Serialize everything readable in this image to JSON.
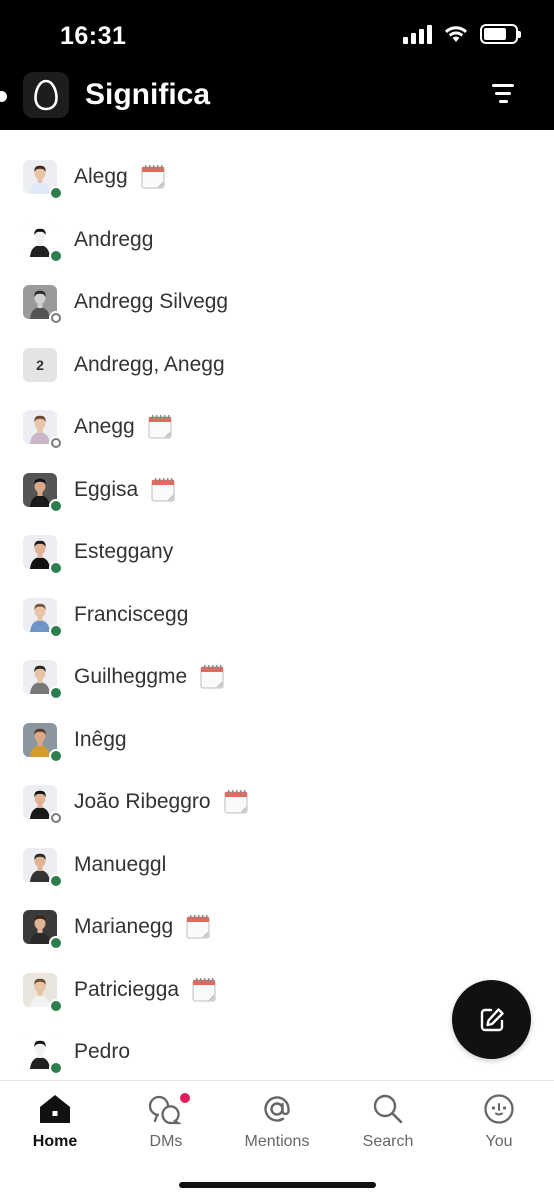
{
  "status_bar": {
    "time": "16:31"
  },
  "header": {
    "workspace_name": "Significa"
  },
  "conversations": [
    {
      "name": "Alegg",
      "presence": "active",
      "calendar": true,
      "kind": "person",
      "skin": "#e8c4a6",
      "hair": "#3a2a22",
      "shirt": "#dfe8f5",
      "bg": "#eceef2"
    },
    {
      "name": "Andregg",
      "presence": "active",
      "calendar": false,
      "kind": "person",
      "skin": "#f2f2f2",
      "hair": "#111111",
      "shirt": "#222222",
      "bg": "#ffffff"
    },
    {
      "name": "Andregg Silvegg",
      "presence": "away",
      "calendar": false,
      "kind": "person",
      "skin": "#cfcfcf",
      "hair": "#2b2b2b",
      "shirt": "#555555",
      "bg": "#9a9a9a"
    },
    {
      "name": "Andregg, Anegg",
      "presence": "none",
      "calendar": false,
      "kind": "group",
      "count": "2"
    },
    {
      "name": "Anegg",
      "presence": "away",
      "calendar": true,
      "kind": "person",
      "skin": "#e8c4a6",
      "hair": "#6b4a36",
      "shirt": "#c9b7c7",
      "bg": "#eceef2"
    },
    {
      "name": "Eggisa",
      "presence": "active",
      "calendar": true,
      "kind": "person",
      "skin": "#d9a98a",
      "hair": "#111111",
      "shirt": "#1a1a1a",
      "bg": "#555555"
    },
    {
      "name": "Esteggany",
      "presence": "active",
      "calendar": false,
      "kind": "person",
      "skin": "#e0b394",
      "hair": "#1a1a1a",
      "shirt": "#111111",
      "bg": "#eceef2"
    },
    {
      "name": "Franciscegg",
      "presence": "active",
      "calendar": false,
      "kind": "person",
      "skin": "#e8c4a6",
      "hair": "#7a5a3e",
      "shirt": "#6f95c7",
      "bg": "#eceef2"
    },
    {
      "name": "Guilheggme",
      "presence": "active",
      "calendar": true,
      "kind": "person",
      "skin": "#e8c4a6",
      "hair": "#2a2a2a",
      "shirt": "#777777",
      "bg": "#eceef2"
    },
    {
      "name": "Inêgg",
      "presence": "active",
      "calendar": false,
      "kind": "person",
      "skin": "#d9a98a",
      "hair": "#5a3a24",
      "shirt": "#d29a2f",
      "bg": "#8a97a0"
    },
    {
      "name": "João Ribeggro",
      "presence": "away",
      "calendar": true,
      "kind": "person",
      "skin": "#e0b394",
      "hair": "#111111",
      "shirt": "#1a1a1a",
      "bg": "#eceef2"
    },
    {
      "name": "Manueggl",
      "presence": "active",
      "calendar": false,
      "kind": "person",
      "skin": "#e0b394",
      "hair": "#2a2a2a",
      "shirt": "#333333",
      "bg": "#eceef2"
    },
    {
      "name": "Marianegg",
      "presence": "active",
      "calendar": true,
      "kind": "person",
      "skin": "#e0b394",
      "hair": "#3a2418",
      "shirt": "#2a2a2a",
      "bg": "#3a3a3a"
    },
    {
      "name": "Patriciegga",
      "presence": "active",
      "calendar": true,
      "kind": "person",
      "skin": "#e8c4a6",
      "hair": "#6b4a30",
      "shirt": "#f2f2f2",
      "bg": "#e9e4dc"
    },
    {
      "name": "Pedro",
      "presence": "active",
      "calendar": false,
      "kind": "person",
      "skin": "#f2f2f2",
      "hair": "#111111",
      "shirt": "#222222",
      "bg": "#ffffff"
    }
  ],
  "tabs": [
    {
      "label": "Home",
      "icon": "home-icon",
      "active": true
    },
    {
      "label": "DMs",
      "icon": "dms-icon",
      "active": false,
      "badge": true
    },
    {
      "label": "Mentions",
      "icon": "at-icon",
      "active": false
    },
    {
      "label": "Search",
      "icon": "search-icon",
      "active": false
    },
    {
      "label": "You",
      "icon": "you-icon",
      "active": false
    }
  ],
  "colors": {
    "header_bg": "#000000",
    "presence_active": "#2e7d4f",
    "badge": "#e01e5a",
    "text": "#333333"
  }
}
